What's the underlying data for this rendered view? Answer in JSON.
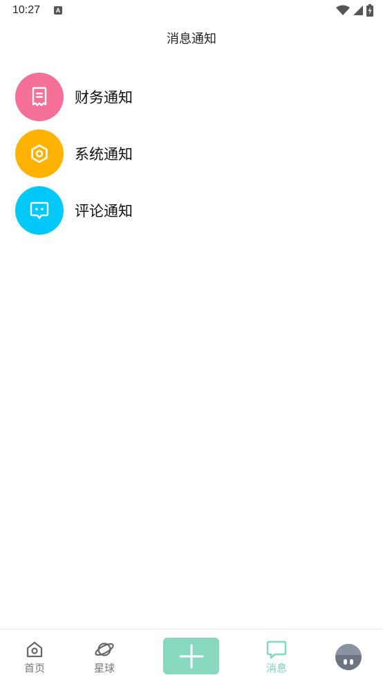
{
  "status_bar": {
    "time": "10:27",
    "a_icon": "A"
  },
  "header": {
    "title": "消息通知"
  },
  "notifications": [
    {
      "label": "财务通知",
      "icon": "receipt-icon",
      "color": "#f57099"
    },
    {
      "label": "系统通知",
      "icon": "hexagon-nut-icon",
      "color": "#ffb300"
    },
    {
      "label": "评论通知",
      "icon": "chat-face-icon",
      "color": "#00c8f8"
    }
  ],
  "tabs": {
    "home": {
      "label": "首页",
      "icon": "home-icon"
    },
    "planet": {
      "label": "星球",
      "icon": "planet-icon"
    },
    "add": {
      "icon": "plus-icon",
      "color": "#88d8c0"
    },
    "messages": {
      "label": "消息",
      "icon": "message-icon",
      "active": true
    },
    "profile": {
      "icon": "avatar-icon"
    }
  },
  "colors": {
    "accent": "#7dd6bd",
    "tab_inactive": "#777777"
  }
}
